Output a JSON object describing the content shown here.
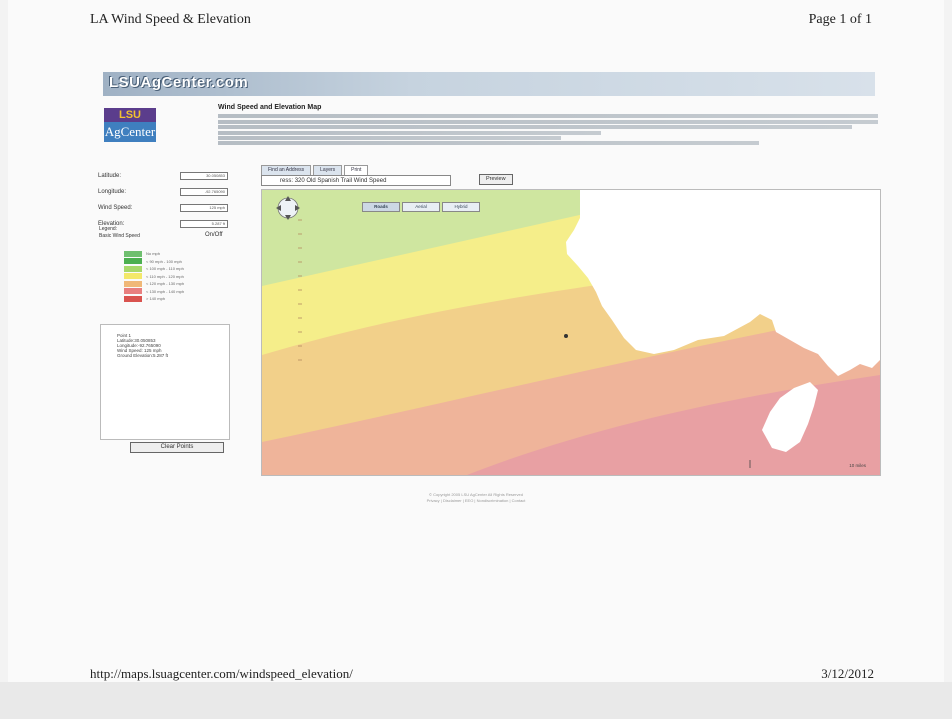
{
  "print_header": {
    "title": "LA Wind Speed & Elevation",
    "page": "Page 1 of 1"
  },
  "print_footer": {
    "url": "http://maps.lsuagcenter.com/windspeed_elevation/",
    "date": "3/12/2012"
  },
  "site": {
    "logo": "LSUAgCenter.com",
    "agcenter_top": "LSU",
    "agcenter_bottom": "AgCenter"
  },
  "intro": {
    "title": "Wind Speed and Elevation Map"
  },
  "form": {
    "latitude_label": "Latitude:",
    "latitude_value": "30.050853",
    "longitude_label": "Longitude:",
    "longitude_value": "-92.765090",
    "wind_label": "Wind Speed:",
    "wind_value": "125 mph",
    "elevation_label": "Elevation:",
    "elevation_value": "5.287 ft"
  },
  "legend": {
    "title_line1": "Legend:",
    "title_line2": "Basic Wind Speed",
    "toggle": "On/Off",
    "items": [
      {
        "label": "No mph",
        "color": "#6fbf6f"
      },
      {
        "label": "< 90 mph - 100 mph",
        "color": "#4caf50"
      },
      {
        "label": "< 100 mph - 110 mph",
        "color": "#a8d86a"
      },
      {
        "label": "< 110 mph - 120 mph",
        "color": "#f3e86a"
      },
      {
        "label": "< 120 mph - 130 mph",
        "color": "#f0b878"
      },
      {
        "label": "< 130 mph - 140 mph",
        "color": "#e87f7f"
      },
      {
        "label": "> 140 mph",
        "color": "#d9534f"
      }
    ]
  },
  "point_info": {
    "lines": [
      "Point 1",
      "Latitude:30.050853",
      "Longitude:-92.765090",
      "Wind Speed: 125 mph",
      "Ground Elevation:5.287 ft"
    ],
    "clear_button": "Clear Points"
  },
  "map": {
    "tabs": [
      "Find an Address",
      "Layers",
      "Print"
    ],
    "active_tab": "Print",
    "address_prefix": "ress:",
    "address_value": "320 Old Spanish Trail Wind Speed",
    "preview_button": "Preview",
    "map_types": [
      "Roads",
      "Aerial",
      "Hybrid"
    ],
    "active_map_type": "Roads",
    "scale_label": "10 miles",
    "zone_colors": [
      "#cfe6a0",
      "#f5ee8a",
      "#f2d08a",
      "#efb49a",
      "#e8a0a3"
    ]
  },
  "copyright": {
    "line1": "© Copyright 2005 LSU AgCenter All Rights Reserved",
    "line2": "Privacy | Disclaimer | EEO | Nondiscrimination | Contact"
  }
}
